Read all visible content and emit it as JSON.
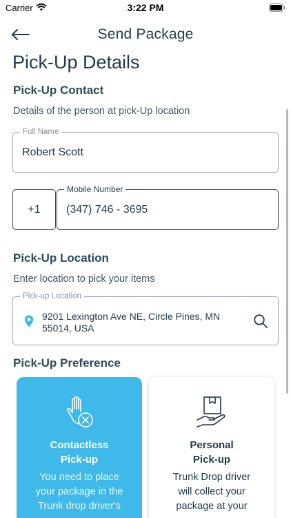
{
  "status_bar": {
    "carrier": "Carrier",
    "time": "3:22 PM"
  },
  "header": {
    "title": "Send Package"
  },
  "page": {
    "title": "Pick-Up Details"
  },
  "contact": {
    "title": "Pick-Up Contact",
    "description": "Details of the person at pick-Up location",
    "full_name": {
      "label": "Full Name",
      "value": "Robert Scott"
    },
    "country_code": "+1",
    "mobile": {
      "label": "Mobile Number",
      "value": "(347) 746 - 3695"
    }
  },
  "location": {
    "title": "Pick-Up Location",
    "description": "Enter location to pick your items",
    "field": {
      "label": "Pick-up Location",
      "line1": "9201 Lexington Ave NE, Circle Pines, MN",
      "line2": "55014, USA"
    }
  },
  "preference": {
    "title": "Pick-Up Preference",
    "options": [
      {
        "title_line1": "Contactless",
        "title_line2": "Pick-up",
        "desc_lines": [
          "You need to place",
          "your package in the",
          "Trunk drop driver's"
        ],
        "selected": true
      },
      {
        "title_line1": "Personal",
        "title_line2": "Pick-up",
        "desc_lines": [
          "Trunk Drop driver",
          "will collect your",
          "package at your"
        ],
        "selected": false
      }
    ]
  },
  "colors": {
    "accent": "#3fb8ea",
    "text": "#1f3a4d",
    "border": "#9fa9b0"
  },
  "icons": [
    "wifi-icon",
    "battery-icon",
    "back-arrow-icon",
    "location-pin-icon",
    "search-icon",
    "hand-cancel-icon",
    "box-hand-icon"
  ]
}
